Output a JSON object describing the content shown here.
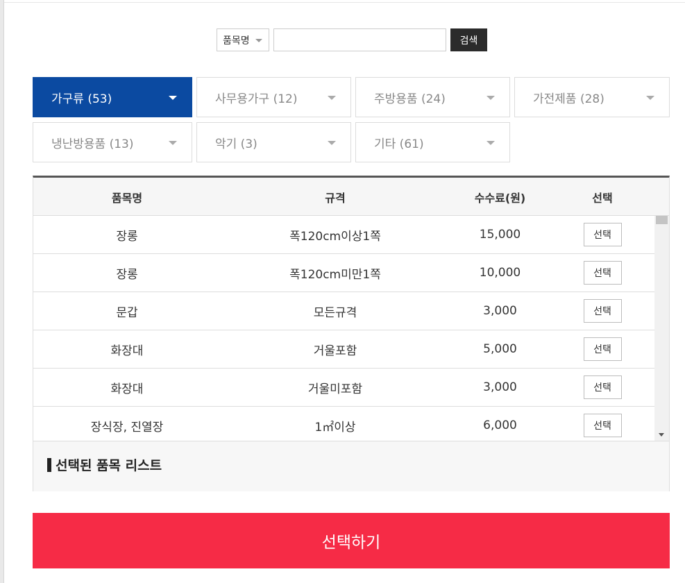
{
  "search": {
    "select_label": "품목명",
    "input_value": "",
    "button_label": "검색"
  },
  "tabs": [
    {
      "label": "가구류 (53)",
      "active": true
    },
    {
      "label": "사무용가구 (12)",
      "active": false
    },
    {
      "label": "주방용품 (24)",
      "active": false
    },
    {
      "label": "가전제품 (28)",
      "active": false
    },
    {
      "label": "냉난방용품 (13)",
      "active": false
    },
    {
      "label": "악기 (3)",
      "active": false
    },
    {
      "label": "기타 (61)",
      "active": false
    }
  ],
  "table": {
    "headers": [
      "품목명",
      "규격",
      "수수료(원)",
      "선택"
    ],
    "rows": [
      {
        "name": "장롱",
        "spec": "폭120cm이상1쪽",
        "fee": "15,000",
        "select": "선택"
      },
      {
        "name": "장롱",
        "spec": "폭120cm미만1쪽",
        "fee": "10,000",
        "select": "선택"
      },
      {
        "name": "문갑",
        "spec": "모든규격",
        "fee": "3,000",
        "select": "선택"
      },
      {
        "name": "화장대",
        "spec": "거울포함",
        "fee": "5,000",
        "select": "선택"
      },
      {
        "name": "화장대",
        "spec": "거울미포함",
        "fee": "3,000",
        "select": "선택"
      },
      {
        "name": "장식장, 진열장",
        "spec": "1㎡이상",
        "fee": "6,000",
        "select": "선택"
      }
    ]
  },
  "selected_list": {
    "title": "선택된 품목 리스트"
  },
  "submit_label": "선택하기",
  "colors": {
    "active_tab": "#0b4aa1",
    "submit": "#f62b46",
    "search_button": "#2b2b2b"
  }
}
